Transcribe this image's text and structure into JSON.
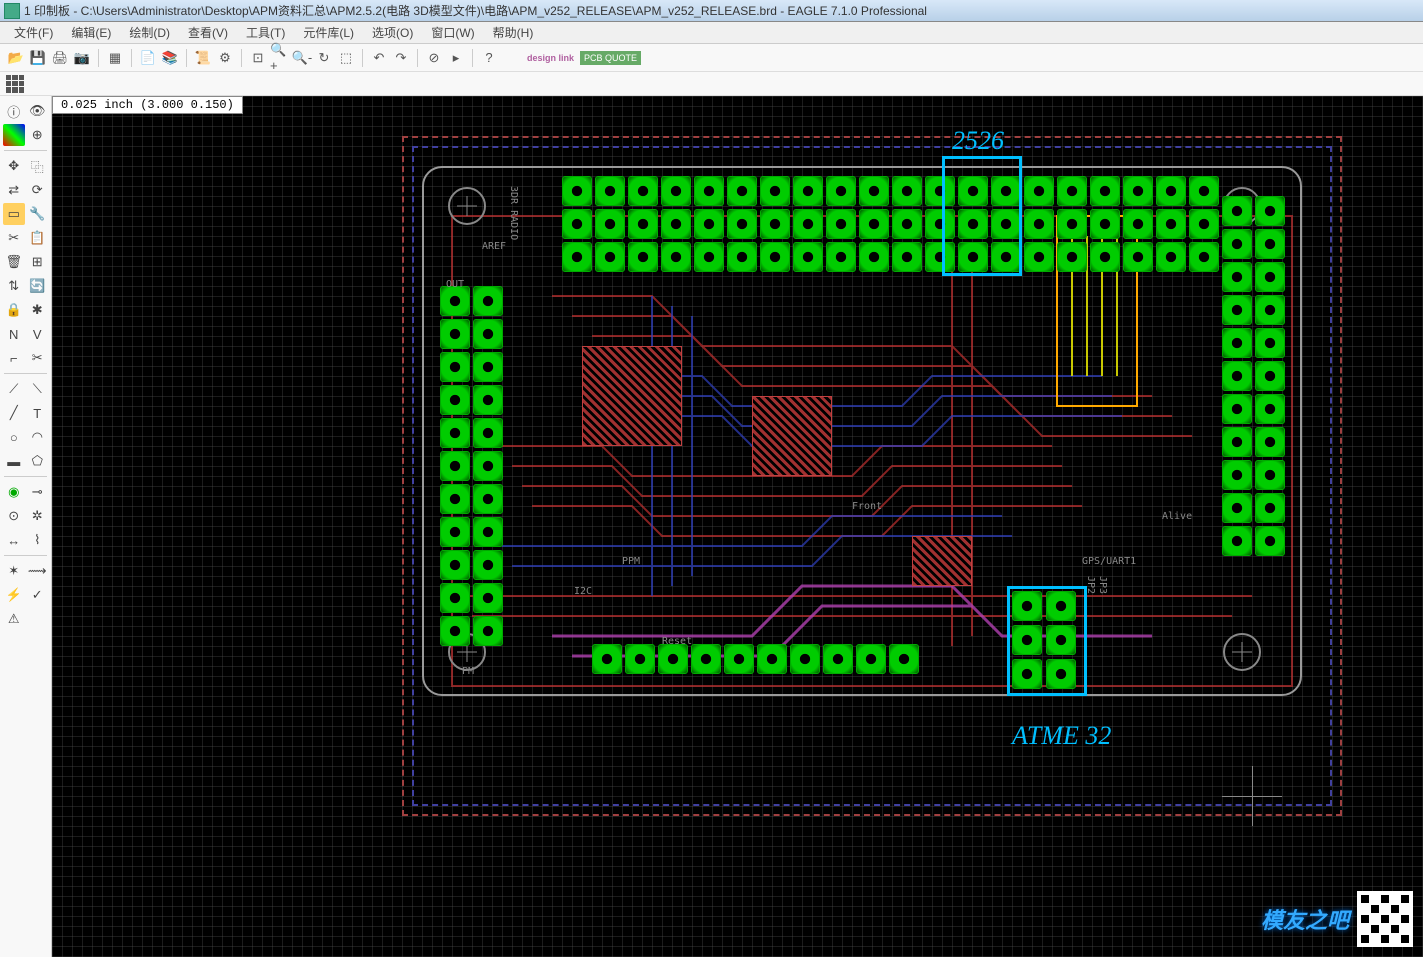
{
  "titlebar": {
    "text": "1 印制板 - C:\\Users\\Administrator\\Desktop\\APM资料汇总\\APM2.5.2(电路 3D模型文件)\\电路\\APM_v252_RELEASE\\APM_v252_RELEASE.brd - EAGLE 7.1.0 Professional"
  },
  "menu": {
    "file": "文件(F)",
    "edit": "编辑(E)",
    "draw": "绘制(D)",
    "view": "查看(V)",
    "tools": "工具(T)",
    "library": "元件库(L)",
    "options": "选项(O)",
    "window": "窗口(W)",
    "help": "帮助(H)"
  },
  "toolbar_badges": {
    "designlink": "design link",
    "pcbquote": "PCB QUOTE"
  },
  "coord_bar": "0.025  inch  (3.000  0.150)",
  "annotations": {
    "top": "2526",
    "bottom": "ATME 32"
  },
  "silk_labels": {
    "aref": "AREF",
    "out": "OUT",
    "radio": "3DR RADIO",
    "reset": "Reset",
    "i2c": "I2C",
    "pm": "PM",
    "ppm": "PPM",
    "front": "Front",
    "gps": "GPS/UART1",
    "alive": "Alive",
    "jp2": "JP2",
    "jp3": "JP3"
  },
  "watermark": {
    "text": "模友之吧"
  }
}
